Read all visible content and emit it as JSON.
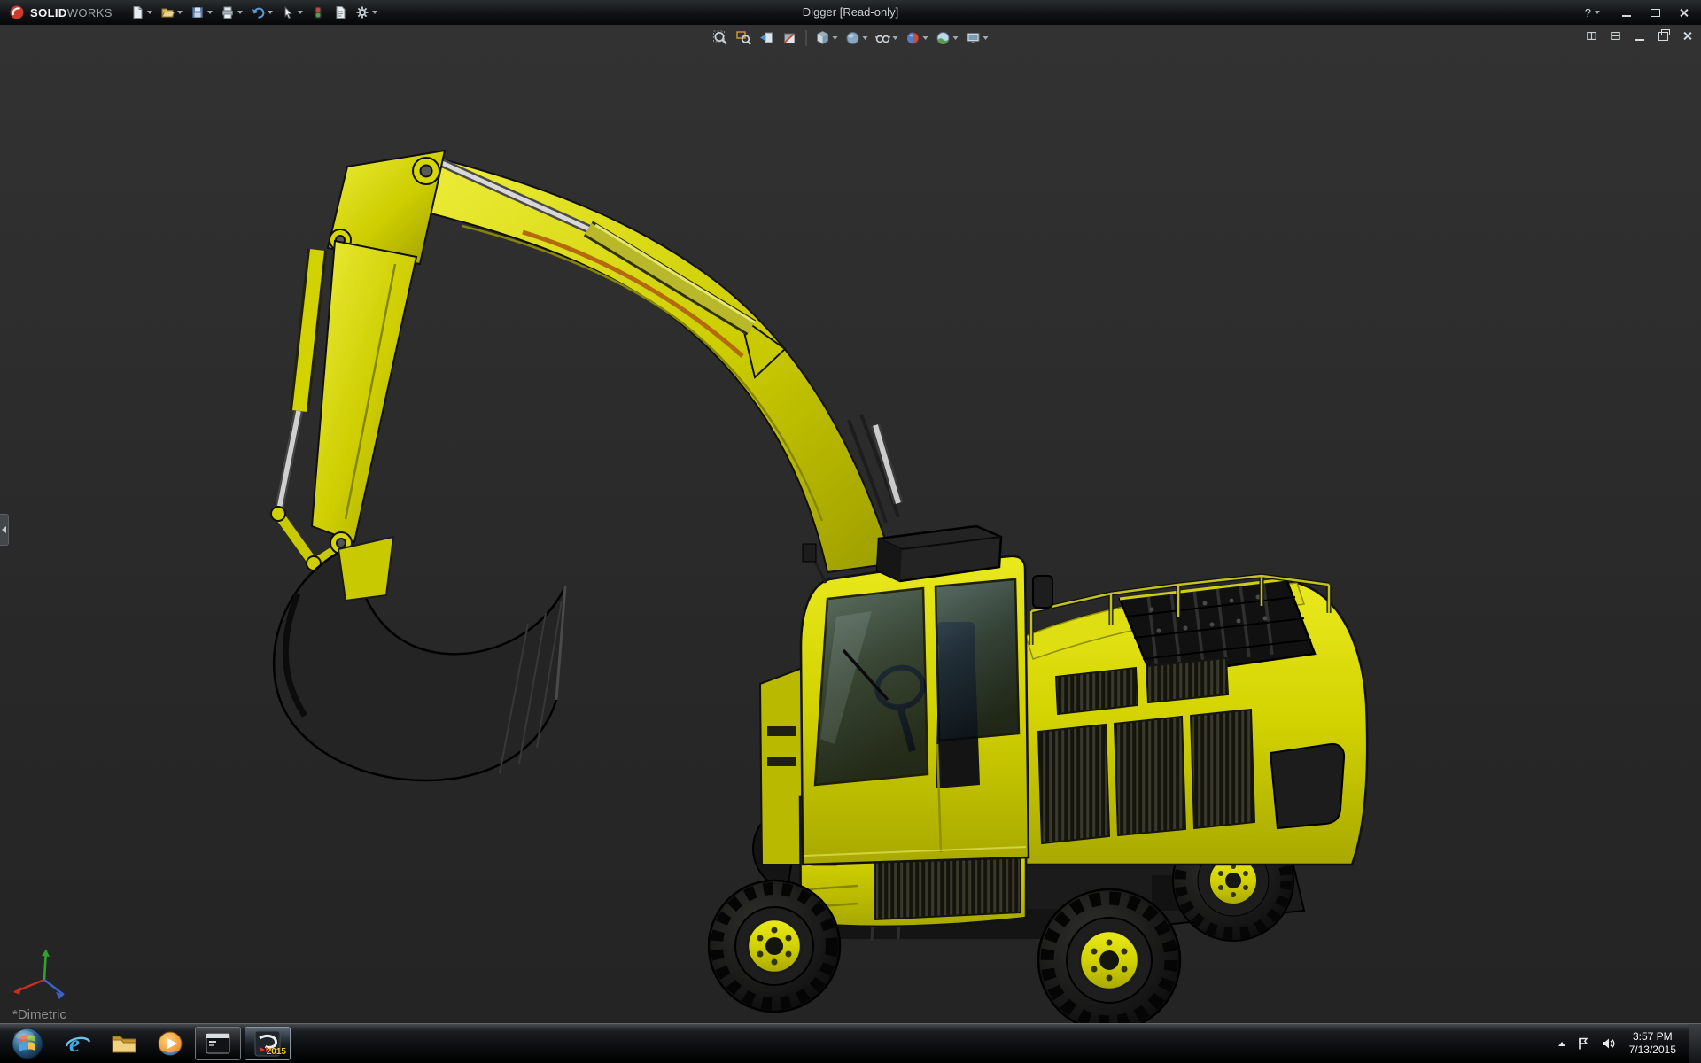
{
  "app": {
    "brand_bold": "SOLID",
    "brand_light": "WORKS",
    "window_title": "Digger [Read-only]",
    "help_label": "?"
  },
  "titlebar_toolbar": {
    "buttons": [
      "new-document",
      "open",
      "save",
      "print",
      "undo",
      "select",
      "rebuild",
      "file-properties",
      "options"
    ]
  },
  "headsup_toolbar": {
    "buttons": [
      "zoom-to-fit",
      "zoom-to-area",
      "previous-view",
      "section-view",
      "view-orientation",
      "display-style",
      "hide-show-items",
      "edit-appearance",
      "apply-scene",
      "view-settings"
    ]
  },
  "document_controls": [
    "split-view",
    "pane-toggle",
    "minimize",
    "restore",
    "close"
  ],
  "viewport": {
    "view_label": "*Dimetric",
    "model": "Digger wheeled excavator 3D model",
    "model_color": "#d2d200",
    "background": "#2a2a2a",
    "triad_colors": {
      "x": "#cc2b20",
      "y": "#2fa32f",
      "z": "#3b62c9"
    }
  },
  "taskbar": {
    "items": [
      "start",
      "internet-explorer",
      "file-explorer",
      "windows-media-player",
      "command-prompt",
      "solidworks-2015"
    ],
    "solidworks_badge": "2015",
    "tray": [
      "show-hidden-icons",
      "action-center",
      "volume"
    ],
    "clock_time": "3:57 PM",
    "clock_date": "7/13/2015"
  }
}
